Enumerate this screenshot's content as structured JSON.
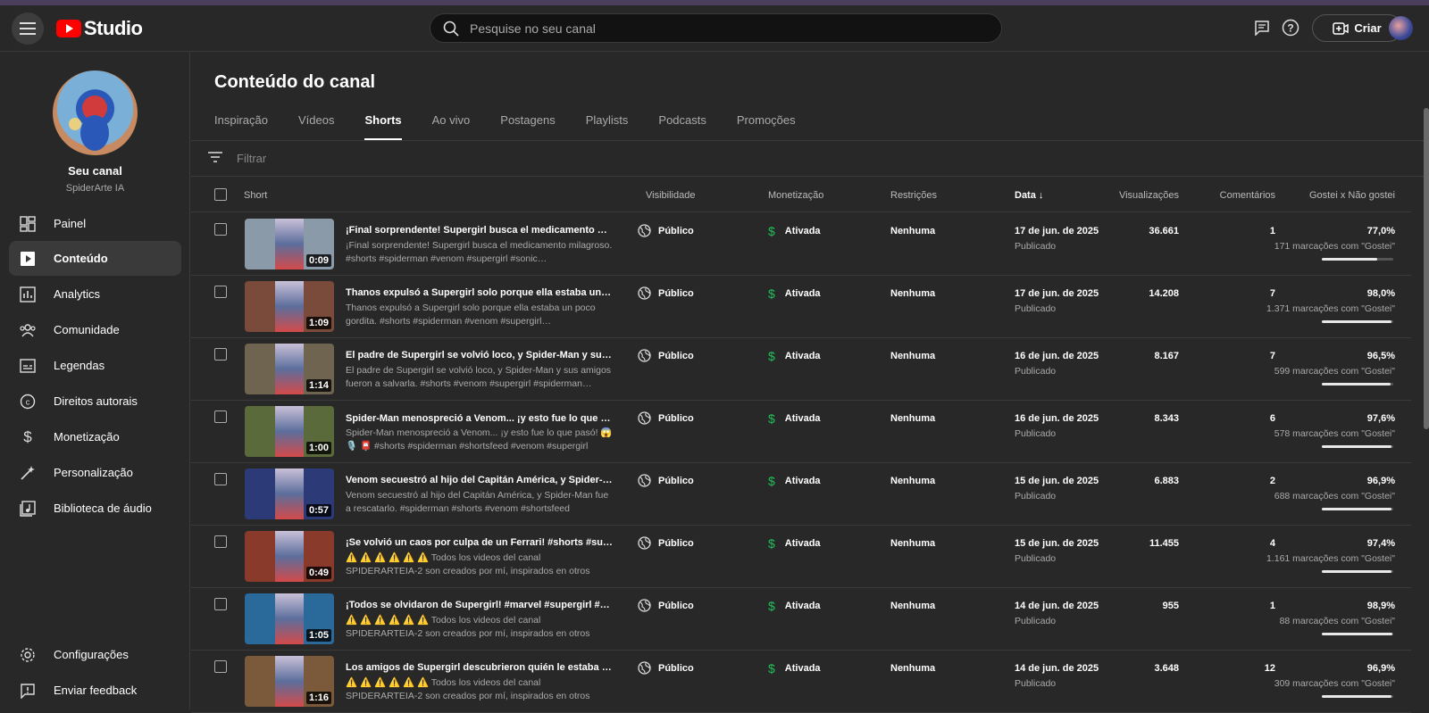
{
  "app": {
    "logo_text": "Studio"
  },
  "header": {
    "search_placeholder": "Pesquise no seu canal",
    "create_label": "Criar"
  },
  "channel": {
    "name": "Seu canal",
    "handle": "SpiderArte IA"
  },
  "sidebar": {
    "items": [
      {
        "label": "Painel",
        "icon": "dashboard-icon"
      },
      {
        "label": "Conteúdo",
        "icon": "content-icon"
      },
      {
        "label": "Analytics",
        "icon": "analytics-icon"
      },
      {
        "label": "Comunidade",
        "icon": "community-icon"
      },
      {
        "label": "Legendas",
        "icon": "subtitles-icon"
      },
      {
        "label": "Direitos autorais",
        "icon": "copyright-icon"
      },
      {
        "label": "Monetização",
        "icon": "dollar-icon"
      },
      {
        "label": "Personalização",
        "icon": "wand-icon"
      },
      {
        "label": "Biblioteca de áudio",
        "icon": "audio-library-icon"
      }
    ],
    "bottom": [
      {
        "label": "Configurações",
        "icon": "gear-icon"
      },
      {
        "label": "Enviar feedback",
        "icon": "feedback-icon"
      }
    ]
  },
  "main": {
    "title": "Conteúdo do canal",
    "tabs": [
      "Inspiração",
      "Vídeos",
      "Shorts",
      "Ao vivo",
      "Postagens",
      "Playlists",
      "Podcasts",
      "Promoções"
    ],
    "active_tab": "Shorts",
    "filter_placeholder": "Filtrar"
  },
  "table": {
    "headers": {
      "short": "Short",
      "visibility": "Visibilidade",
      "monetization": "Monetização",
      "restrictions": "Restrições",
      "date": "Data",
      "views": "Visualizações",
      "comments": "Comentários",
      "likes": "Gostei x Não gostei"
    },
    "rows": [
      {
        "title": "¡Final sorprendente! Supergirl busca el medicamento milagroso. #shorts #spiderman",
        "desc": "¡Final sorprendente! Supergirl busca el medicamento milagroso. #shorts #spiderman #venom #supergirl #sonic…",
        "duration": "0:09",
        "visibility": "Público",
        "monetization": "Ativada",
        "restrictions": "Nenhuma",
        "date": "17 de jun. de 2025",
        "status": "Publicado",
        "views": "36.661",
        "comments": "1",
        "pct": "77,0%",
        "likes": "171 marcações com \"Gostei\"",
        "ratio": 0.77,
        "color": "#8a9aa8"
      },
      {
        "title": "Thanos expulsó a Supergirl solo porque ella estaba un poco gordita",
        "desc": "Thanos expulsó a Supergirl solo porque ella estaba un poco gordita. #shorts #spiderman #venom #supergirl…",
        "duration": "1:09",
        "visibility": "Público",
        "monetization": "Ativada",
        "restrictions": "Nenhuma",
        "date": "17 de jun. de 2025",
        "status": "Publicado",
        "views": "14.208",
        "comments": "7",
        "pct": "98,0%",
        "likes": "1.371 marcações com \"Gostei\"",
        "ratio": 0.98,
        "color": "#7a4a3a"
      },
      {
        "title": "El padre de Supergirl se volvió loco, y Spider-Man y sus amigos fueron a salvarla",
        "desc": "El padre de Supergirl se volvió loco, y Spider-Man y sus amigos fueron a salvarla. #shorts #venom #supergirl #spiderman…",
        "duration": "1:14",
        "visibility": "Público",
        "monetization": "Ativada",
        "restrictions": "Nenhuma",
        "date": "16 de jun. de 2025",
        "status": "Publicado",
        "views": "8.167",
        "comments": "7",
        "pct": "96,5%",
        "likes": "599 marcações com \"Gostei\"",
        "ratio": 0.965,
        "color": "#6e6450"
      },
      {
        "title": "Spider-Man menospreció a Venom... ¡y esto fue lo que pasó! 😱🎙️",
        "desc": "Spider-Man menospreció a Venom... ¡y esto fue lo que pasó! 😱🎙️ 📮 #shorts #spiderman #shortsfeed #venom #supergirl #sonic",
        "duration": "1:00",
        "visibility": "Público",
        "monetization": "Ativada",
        "restrictions": "Nenhuma",
        "date": "16 de jun. de 2025",
        "status": "Publicado",
        "views": "8.343",
        "comments": "6",
        "pct": "97,6%",
        "likes": "578 marcações com \"Gostei\"",
        "ratio": 0.976,
        "color": "#5a6a3a"
      },
      {
        "title": "Venom secuestró al hijo del Capitán América, y Spider-Man fue a rescatarlo",
        "desc": "Venom secuestró al hijo del Capitán América, y Spider-Man fue a rescatarlo. #spiderman #shorts #venom #shortsfeed #supergirl…",
        "duration": "0:57",
        "visibility": "Público",
        "monetization": "Ativada",
        "restrictions": "Nenhuma",
        "date": "15 de jun. de 2025",
        "status": "Publicado",
        "views": "6.883",
        "comments": "2",
        "pct": "96,9%",
        "likes": "688 marcações com \"Gostei\"",
        "ratio": 0.969,
        "color": "#2c3a78"
      },
      {
        "title": "¡Se volvió un caos por culpa de un Ferrari! #shorts #supergirl #spiderman",
        "desc": "⚠️ ⚠️ ⚠️ ⚠️ ⚠️ ⚠️ Todos los videos del canal SPIDERARTEIA-2 son creados por mí, inspirados en otros canales, con imágenes…",
        "duration": "0:49",
        "visibility": "Público",
        "monetization": "Ativada",
        "restrictions": "Nenhuma",
        "date": "15 de jun. de 2025",
        "status": "Publicado",
        "views": "11.455",
        "comments": "4",
        "pct": "97,4%",
        "likes": "1.161 marcações com \"Gostei\"",
        "ratio": 0.974,
        "color": "#8a3a2a"
      },
      {
        "title": "¡Todos se olvidaron de Supergirl! #marvel #supergirl #spiderman",
        "desc": "⚠️ ⚠️ ⚠️ ⚠️ ⚠️ ⚠️ Todos los videos del canal SPIDERARTEIA-2 son creados por mí, inspirados en otros canales, con imágenes…",
        "duration": "1:05",
        "visibility": "Público",
        "monetization": "Ativada",
        "restrictions": "Nenhuma",
        "date": "14 de jun. de 2025",
        "status": "Publicado",
        "views": "955",
        "comments": "1",
        "pct": "98,9%",
        "likes": "88 marcações com \"Gostei\"",
        "ratio": 0.989,
        "color": "#2a6a9a"
      },
      {
        "title": "Los amigos de Supergirl descubrieron quién le estaba enviando regalos",
        "desc": "⚠️ ⚠️ ⚠️ ⚠️ ⚠️ ⚠️ Todos los videos del canal SPIDERARTEIA-2 son creados por mí, inspirados en otros canales, con imágenes…",
        "duration": "1:16",
        "visibility": "Público",
        "monetization": "Ativada",
        "restrictions": "Nenhuma",
        "date": "14 de jun. de 2025",
        "status": "Publicado",
        "views": "3.648",
        "comments": "12",
        "pct": "96,9%",
        "likes": "309 marcações com \"Gostei\"",
        "ratio": 0.969,
        "color": "#7a5a3a"
      }
    ]
  }
}
